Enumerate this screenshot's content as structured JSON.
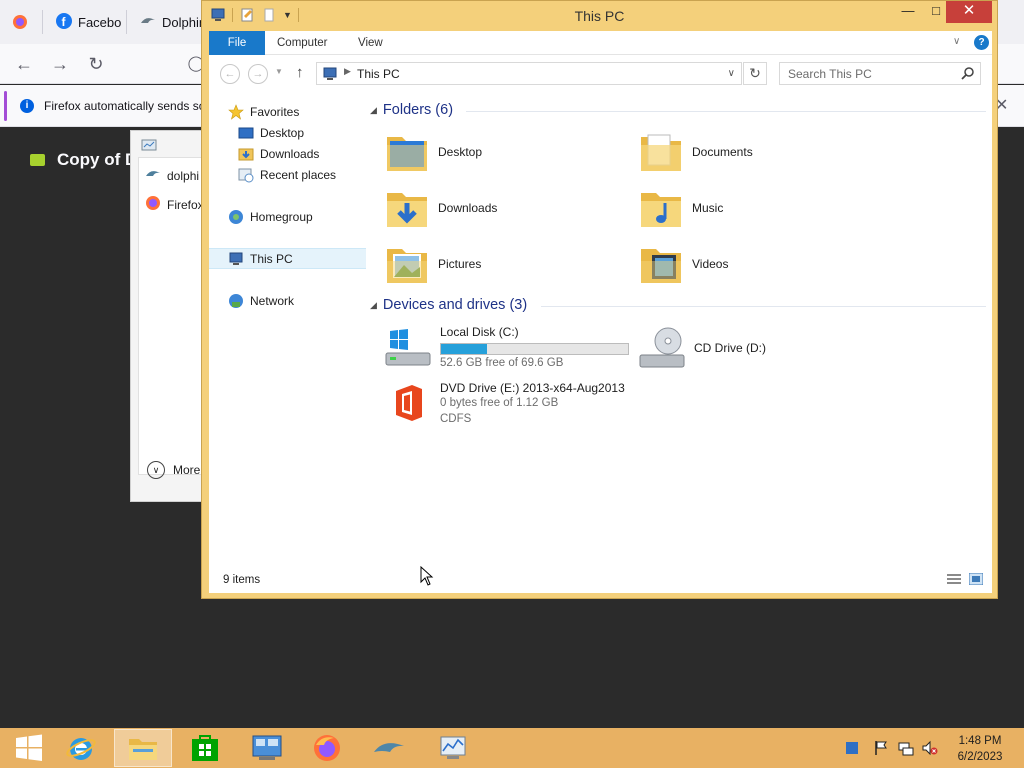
{
  "browser": {
    "tabs": [
      {
        "label": "Facebo",
        "icon": "facebook-icon"
      },
      {
        "label": "Dolphin",
        "icon": "dolphin-icon"
      }
    ],
    "notice": "Firefox automatically sends so",
    "page_title": "Copy of D"
  },
  "popup": {
    "items": [
      {
        "label": "dolphi",
        "icon": "dolphin-icon"
      },
      {
        "label": "Firefox",
        "icon": "firefox-icon"
      }
    ],
    "more_label": "More"
  },
  "explorer": {
    "title": "This PC",
    "window_controls": {
      "minimize": "—",
      "maximize": "□",
      "close": "✕"
    },
    "ribbon_tabs": {
      "file": "File",
      "computer": "Computer",
      "view": "View"
    },
    "address": {
      "crumb": "This PC"
    },
    "search": {
      "placeholder": "Search This PC"
    },
    "nav": {
      "favorites": "Favorites",
      "desktop": "Desktop",
      "downloads": "Downloads",
      "recent": "Recent places",
      "homegroup": "Homegroup",
      "this_pc": "This PC",
      "network": "Network"
    },
    "folders_header": "Folders (6)",
    "folders": {
      "desktop": "Desktop",
      "documents": "Documents",
      "downloads": "Downloads",
      "music": "Music",
      "pictures": "Pictures",
      "videos": "Videos"
    },
    "drives_header": "Devices and drives (3)",
    "drives": {
      "c": {
        "name": "Local Disk (C:)",
        "free": "52.6 GB free of 69.6 GB",
        "used_fraction": 0.244
      },
      "d": {
        "name": "CD Drive (D:)"
      },
      "e": {
        "name": "DVD Drive (E:) 2013-x64-Aug2013",
        "free": "0 bytes free of 1.12 GB",
        "fs": "CDFS"
      }
    },
    "status_count": "9 items"
  },
  "taskbar": {
    "apps": [
      "windows-start-icon",
      "internet-explorer-icon",
      "file-explorer-icon",
      "store-icon",
      "control-panel-icon",
      "firefox-icon",
      "dolphin-icon",
      "performance-monitor-icon"
    ],
    "clock_time": "1:48 PM",
    "clock_date": "6/2/2023"
  },
  "colors": {
    "window_frame": "#f4d07b",
    "taskbar": "#e8b163",
    "accent": "#1979ca",
    "group_header": "#1e3287",
    "close_button": "#c7403a"
  }
}
